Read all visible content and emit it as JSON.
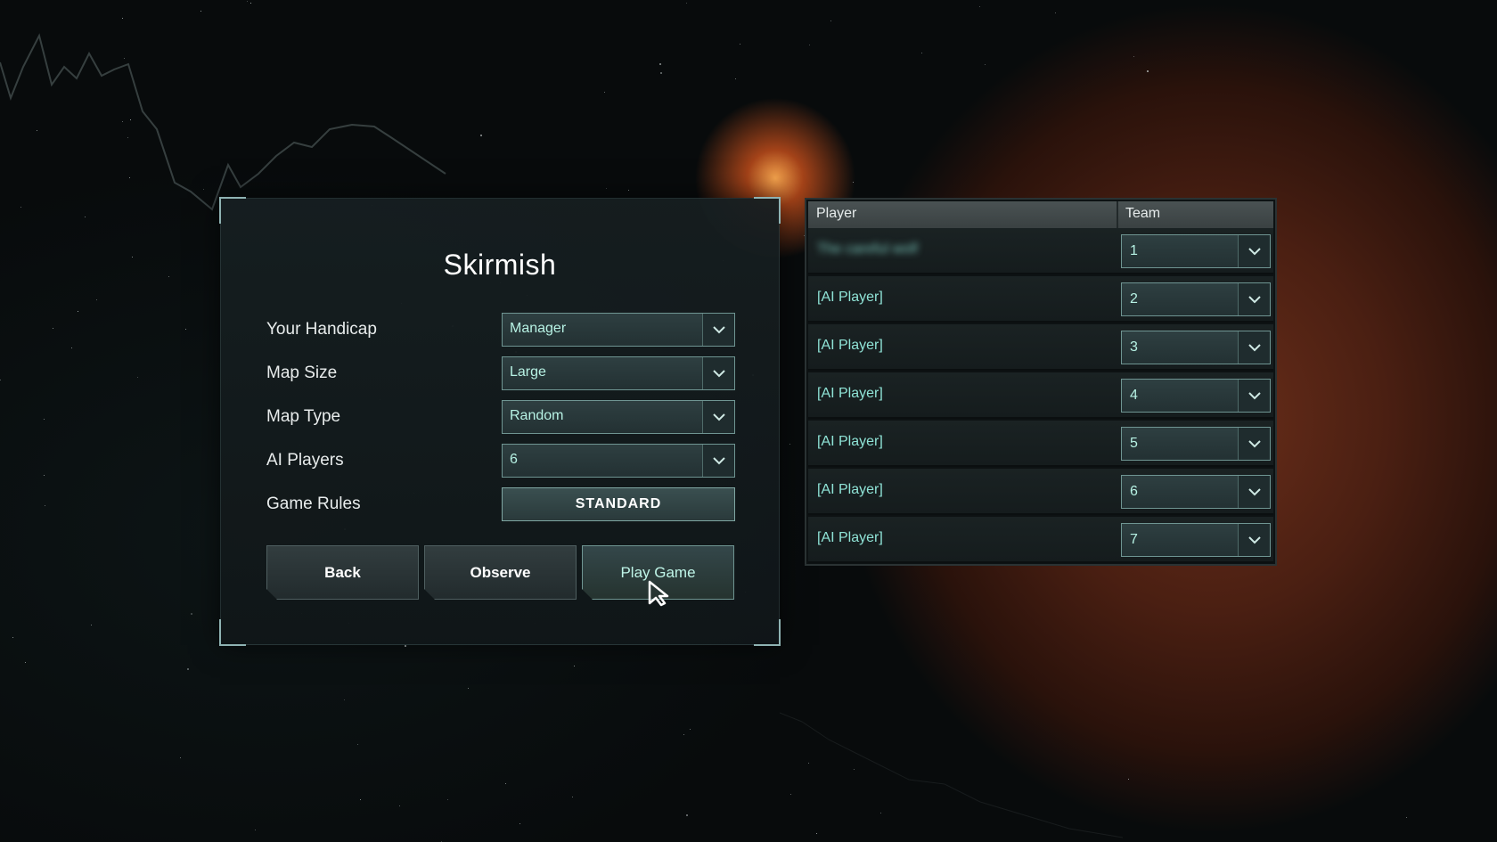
{
  "panel": {
    "title": "Skirmish",
    "settings": [
      {
        "label": "Your Handicap",
        "value": "Manager"
      },
      {
        "label": "Map Size",
        "value": "Large"
      },
      {
        "label": "Map Type",
        "value": "Random"
      },
      {
        "label": "AI Players",
        "value": "6"
      }
    ],
    "game_rules": {
      "label": "Game Rules",
      "button": "STANDARD"
    },
    "buttons": {
      "back": "Back",
      "observe": "Observe",
      "play": "Play Game"
    }
  },
  "table": {
    "headers": {
      "player": "Player",
      "team": "Team"
    },
    "rows": [
      {
        "player": "The careful wolf",
        "team": "1"
      },
      {
        "player": "[AI Player]",
        "team": "2"
      },
      {
        "player": "[AI Player]",
        "team": "3"
      },
      {
        "player": "[AI Player]",
        "team": "4"
      },
      {
        "player": "[AI Player]",
        "team": "5"
      },
      {
        "player": "[AI Player]",
        "team": "6"
      },
      {
        "player": "[AI Player]",
        "team": "7"
      }
    ]
  },
  "colors": {
    "accent": "#8fe3d6",
    "border": "#6f9592",
    "panel": "#161e20"
  },
  "icons": {
    "dropdown": "chevron-down-icon",
    "cursor": "mouse-pointer-icon"
  }
}
